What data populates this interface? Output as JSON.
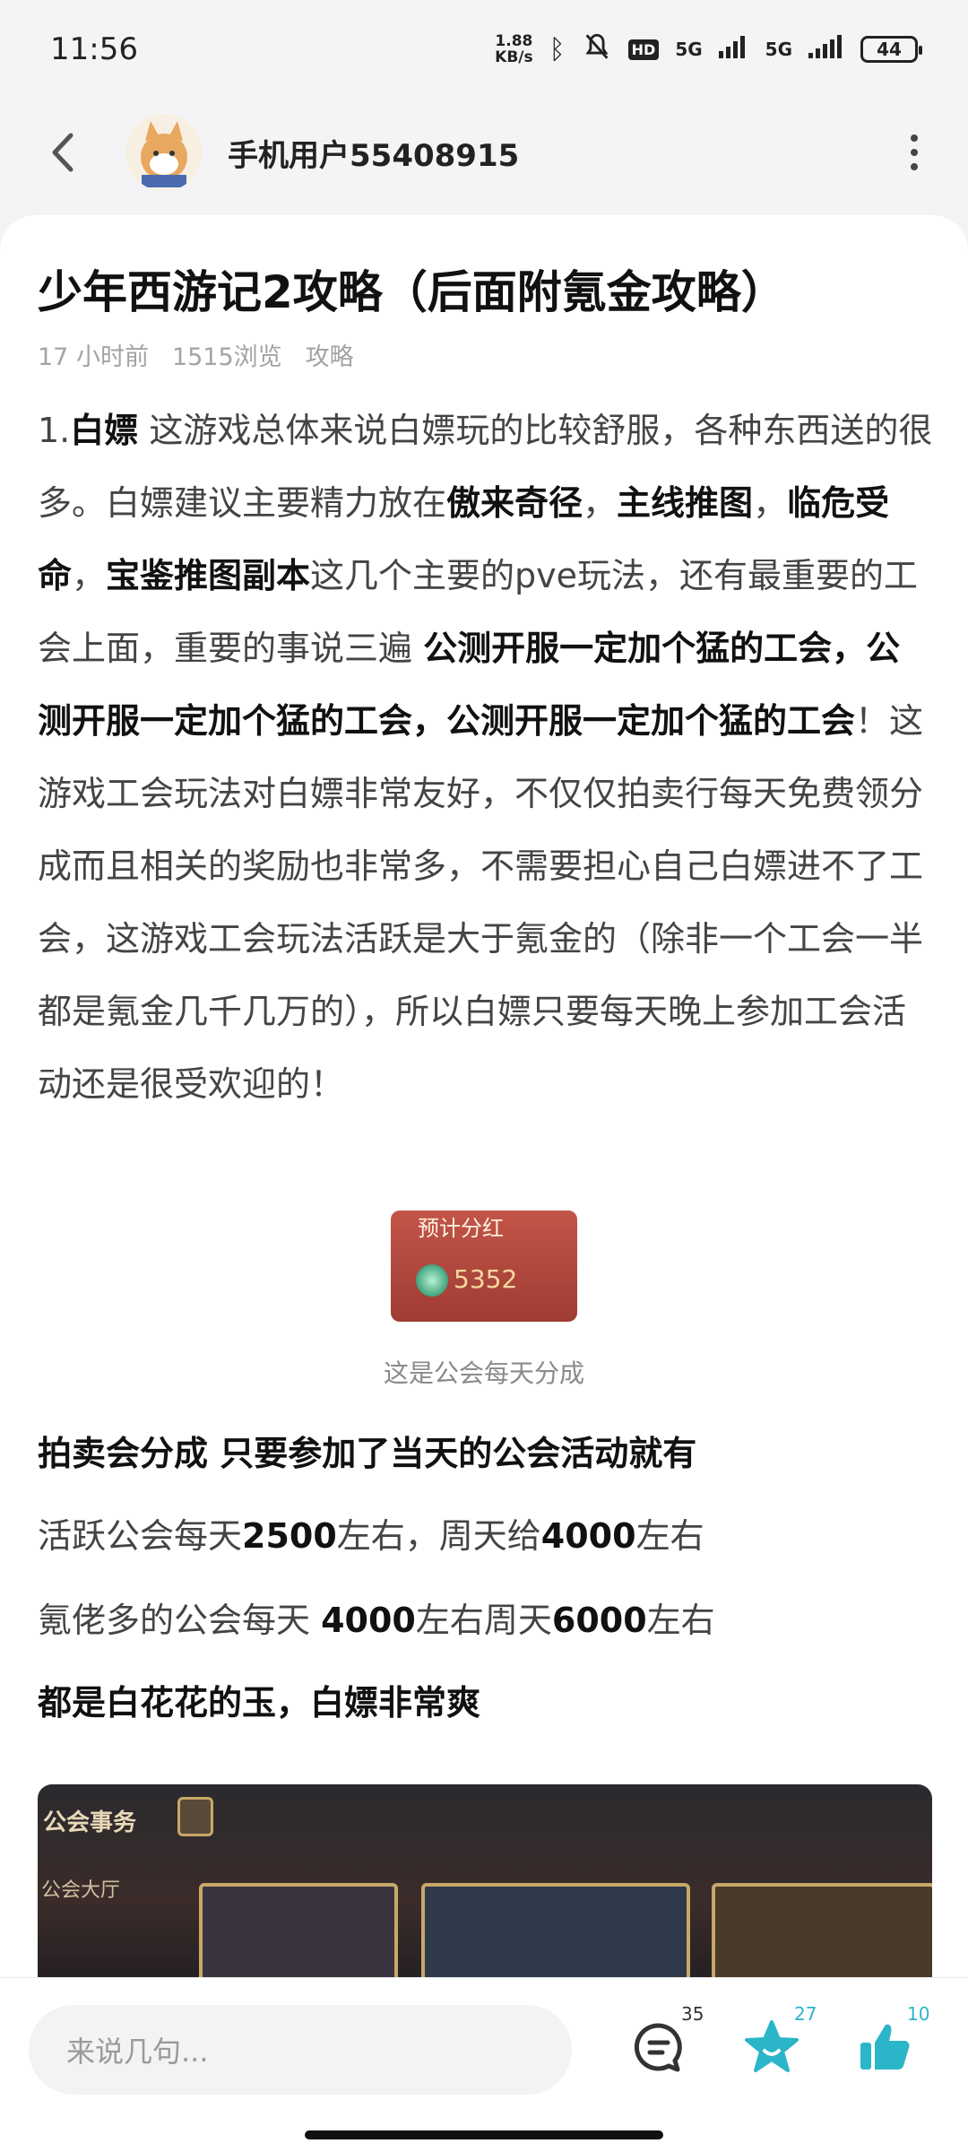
{
  "status": {
    "time": "11:56",
    "speed": "1.88",
    "speed_unit": "KB/s",
    "hd": "HD",
    "sig1": "5G",
    "sig2": "5G",
    "battery": "44"
  },
  "header": {
    "username": "手机用户55408915"
  },
  "post": {
    "title": "少年西游记2攻略（后面附氪金攻略）",
    "time": "17 小时前",
    "views": "1515浏览",
    "category": "攻略",
    "p1": [
      {
        "t": "1.",
        "b": false
      },
      {
        "t": "白嫖",
        "b": true
      },
      {
        "t": "  这游戏总体来说白嫖玩的比较舒服，各种东西送的很多。白嫖建议主要精力放在",
        "b": false
      },
      {
        "t": "傲来奇径",
        "b": true
      },
      {
        "t": "，",
        "b": false
      },
      {
        "t": "主线推图",
        "b": true
      },
      {
        "t": "，",
        "b": false
      },
      {
        "t": "临危受命",
        "b": true
      },
      {
        "t": "，",
        "b": false
      },
      {
        "t": "宝鉴推图副本",
        "b": true
      },
      {
        "t": "这几个主要的pve玩法，还有最重要的工会上面，重要的事说三遍 ",
        "b": false
      },
      {
        "t": "公测开服一定加个猛的工会，公测开服一定加个猛的工会，公测开服一定加个猛的工会",
        "b": true
      },
      {
        "t": "！这游戏工会玩法对白嫖非常友好，不仅仅拍卖行每天免费领分成而且相关的奖励也非常多，不需要担心自己白嫖进不了工会，这游戏工会玩法活跃是大于氪金的（除非一个工会一半都是氪金几千几万的），所以白嫖只要每天晚上参加工会活动还是很受欢迎的！",
        "b": false
      }
    ],
    "image1": {
      "header": "预计分红",
      "value": "5352",
      "caption": "这是公会每天分成"
    },
    "p2": "拍卖会分成 只要参加了当天的公会活动就有",
    "p3": [
      {
        "t": "活跃公会每天",
        "b": false
      },
      {
        "t": "2500",
        "b": true
      },
      {
        "t": "左右，周天给",
        "b": false
      },
      {
        "t": "4000",
        "b": true
      },
      {
        "t": "左右",
        "b": false
      }
    ],
    "p4": [
      {
        "t": "氪佬多的公会每天 ",
        "b": false
      },
      {
        "t": "4000",
        "b": true
      },
      {
        "t": "左右周天",
        "b": false
      },
      {
        "t": "6000",
        "b": true
      },
      {
        "t": "左右",
        "b": false
      }
    ],
    "p5": "都是白花花的玉，白嫖非常爽",
    "image2": {
      "label1": "公会事务",
      "label2": "公会大厅"
    }
  },
  "bottom": {
    "placeholder": "来说几句...",
    "comments": "35",
    "favorites": "27",
    "likes": "10",
    "accent": "#2bb5c9"
  }
}
